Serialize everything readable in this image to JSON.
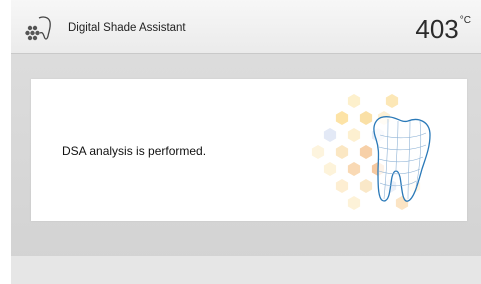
{
  "header": {
    "title": "Digital Shade Assistant",
    "temperature_value": "403",
    "temperature_unit": "°C",
    "icon": "shade-dots-tooth-icon"
  },
  "dialog": {
    "message": "DSA analysis is performed.",
    "illustration": "tooth-shade-hexagons-illustration"
  },
  "colors": {
    "hex_yellow": "#fce9b8",
    "hex_orange": "#f9d6a8",
    "hex_blue": "#dde6f5",
    "tooth_outline": "#2a79b8"
  }
}
